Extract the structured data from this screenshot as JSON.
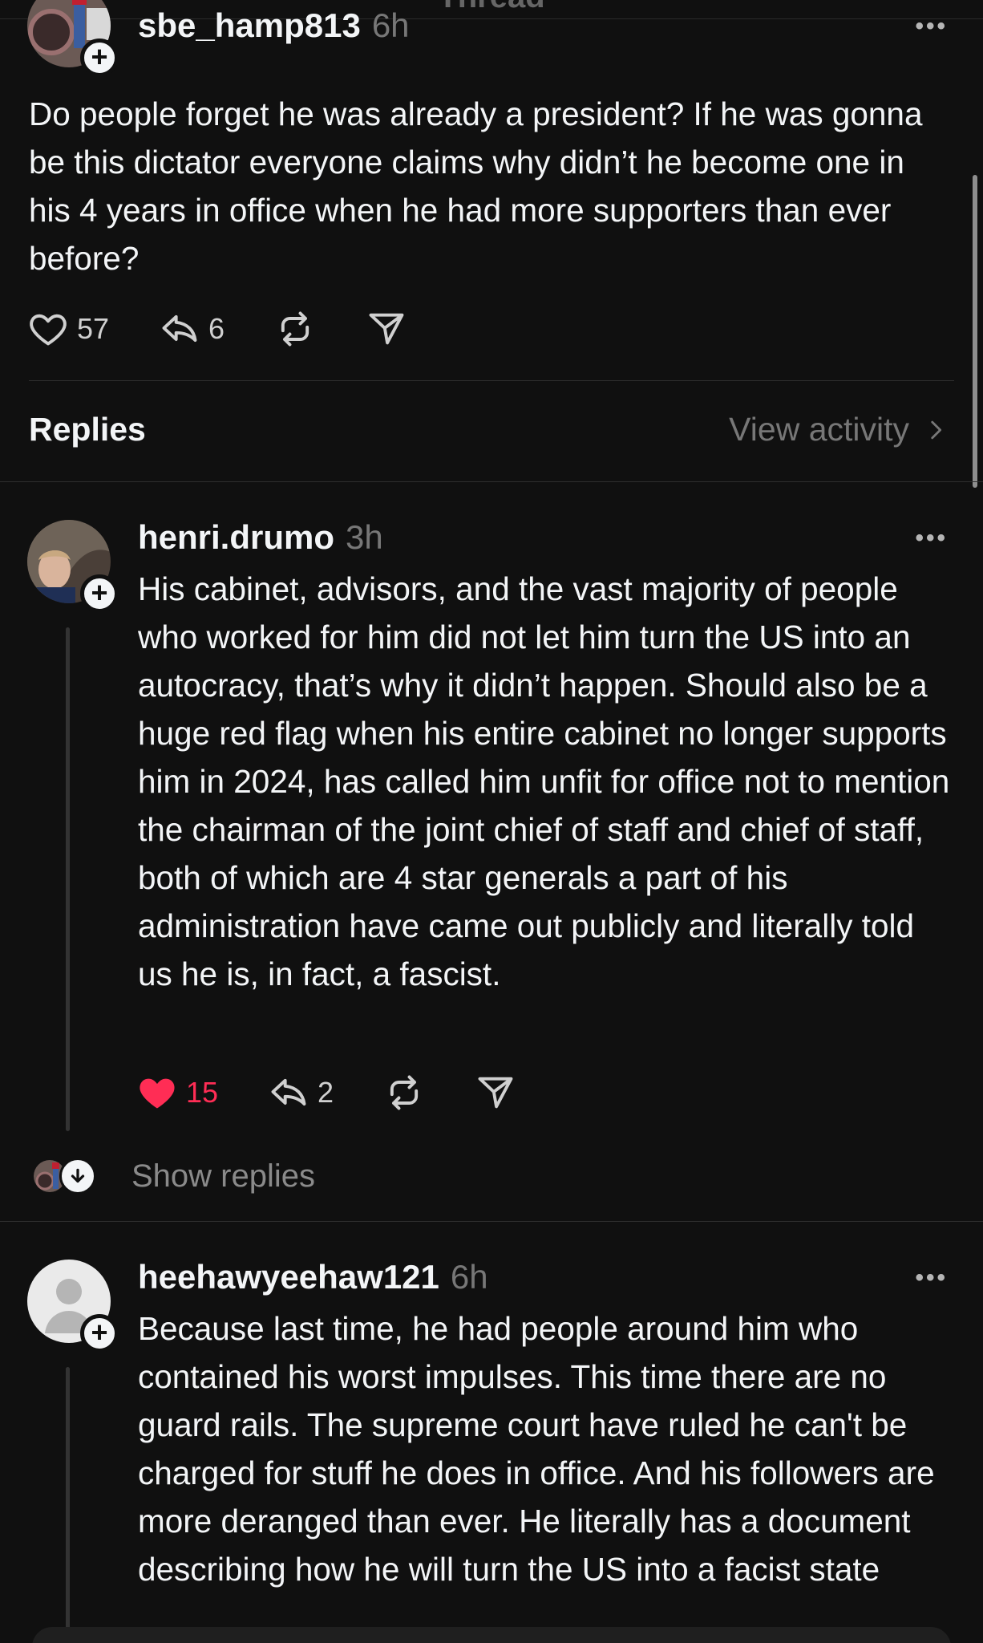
{
  "header": {
    "title_partial": "Thread"
  },
  "post": {
    "username": "sbe_hamp813",
    "time": "6h",
    "text": "Do people forget he was already a president? If he was gonna be this dictator everyone claims why didn’t he become one in his 4 years in office when he had more supporters than ever before?",
    "likes": "57",
    "replies": "6",
    "liked": false
  },
  "replies_section": {
    "title": "Replies",
    "view_activity": "View activity"
  },
  "replies": [
    {
      "username": "henri.drumo",
      "time": "3h",
      "text": "His cabinet, advisors, and the vast majority of people who worked for him did not let him turn the US into an autocracy, that’s why it didn’t happen. Should also be a huge red flag when his entire cabinet no longer supports him in 2024, has called him unfit for office not to mention the chairman of the joint chief of staff and chief of staff, both of which are 4 star generals a part of his administration have came out publicly and literally told us he is, in fact, a fascist.",
      "likes": "15",
      "replies": "2",
      "liked": true,
      "show_replies": "Show replies"
    },
    {
      "username": "heehawyeehaw121",
      "time": "6h",
      "text": "Because last time, he had people around him who contained his worst impulses. This time there are no guard rails. The supreme court have ruled he can't be charged for stuff he does in office. And his followers are more deranged than ever. He literally has a document describing how he will turn the US into a facist state"
    }
  ],
  "icons": {
    "like": "heart-icon",
    "reply": "reply-arrow-icon",
    "repost": "repost-icon",
    "share": "send-icon",
    "more": "more-dots-icon",
    "follow": "plus-icon"
  },
  "colors": {
    "background": "#101010",
    "text": "#f3f5f7",
    "muted": "#777777",
    "like_active": "#ff2d55"
  }
}
